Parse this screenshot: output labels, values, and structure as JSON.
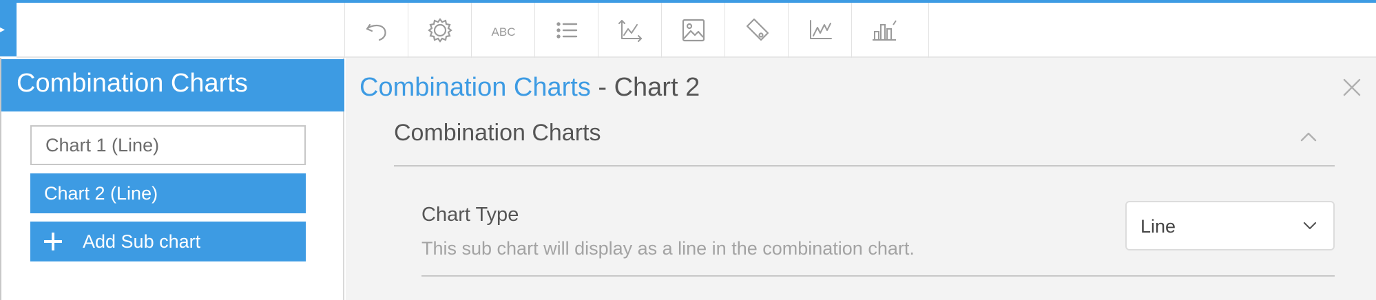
{
  "colors": {
    "accent": "#3d9be3",
    "icon_gray": "#9a9a9a",
    "panel_bg": "#f3f3f3"
  },
  "toolbar": {
    "icons": [
      "undo-icon",
      "settings-icon",
      "text-icon",
      "list-icon",
      "axes-icon",
      "image-icon",
      "tag-icon",
      "line-chart-icon",
      "bar-chart-icon"
    ]
  },
  "sidebar": {
    "title": "Combination Charts",
    "items": [
      {
        "label": "Chart 1 (Line)",
        "state": "outlined"
      },
      {
        "label": "Chart 2 (Line)",
        "state": "selected"
      }
    ],
    "add_label": "Add Sub chart"
  },
  "main": {
    "breadcrumb_link": "Combination Charts",
    "breadcrumb_current": " - Chart 2",
    "section_title": "Combination Charts",
    "chart_type": {
      "label": "Chart Type",
      "description": "This sub chart will display as a line in the combination chart.",
      "value": "Line"
    }
  }
}
